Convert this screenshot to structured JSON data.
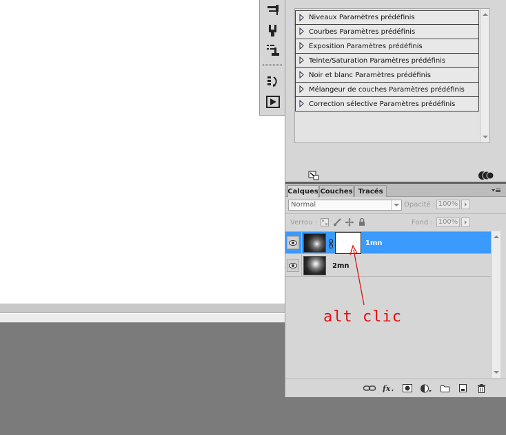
{
  "tools_strip": {
    "icons": [
      "brush-preset-icon",
      "clone-source-icon",
      "tool-presets-icon",
      "actions-history-icon",
      "play-action-icon"
    ]
  },
  "adjustments": {
    "items": [
      "Niveaux Paramètres prédéfinis",
      "Courbes Paramètres prédéfinis",
      "Exposition Paramètres prédéfinis",
      "Teinte/Saturation Paramètres prédéfinis",
      "Noir et blanc Paramètres prédéfinis",
      "Mélangeur de couches Paramètres prédéfinis",
      "Correction sélective Paramètres prédéfinis"
    ]
  },
  "layers_panel": {
    "tabs": [
      "Calques",
      "Couches",
      "Tracés"
    ],
    "active_tab": "Calques",
    "blend_mode": "Normal",
    "opacity_label": "Opacité :",
    "opacity_value": "100%",
    "lock_label": "Verrou :",
    "fill_label": "Fond :",
    "fill_value": "100%",
    "layers": [
      {
        "name": "1mn",
        "selected": true,
        "has_mask": true
      },
      {
        "name": "2mn",
        "selected": false,
        "has_mask": false
      }
    ],
    "selection_color": "#3b9afe"
  },
  "annotation": {
    "text": "alt clic",
    "color": "#e01010"
  }
}
